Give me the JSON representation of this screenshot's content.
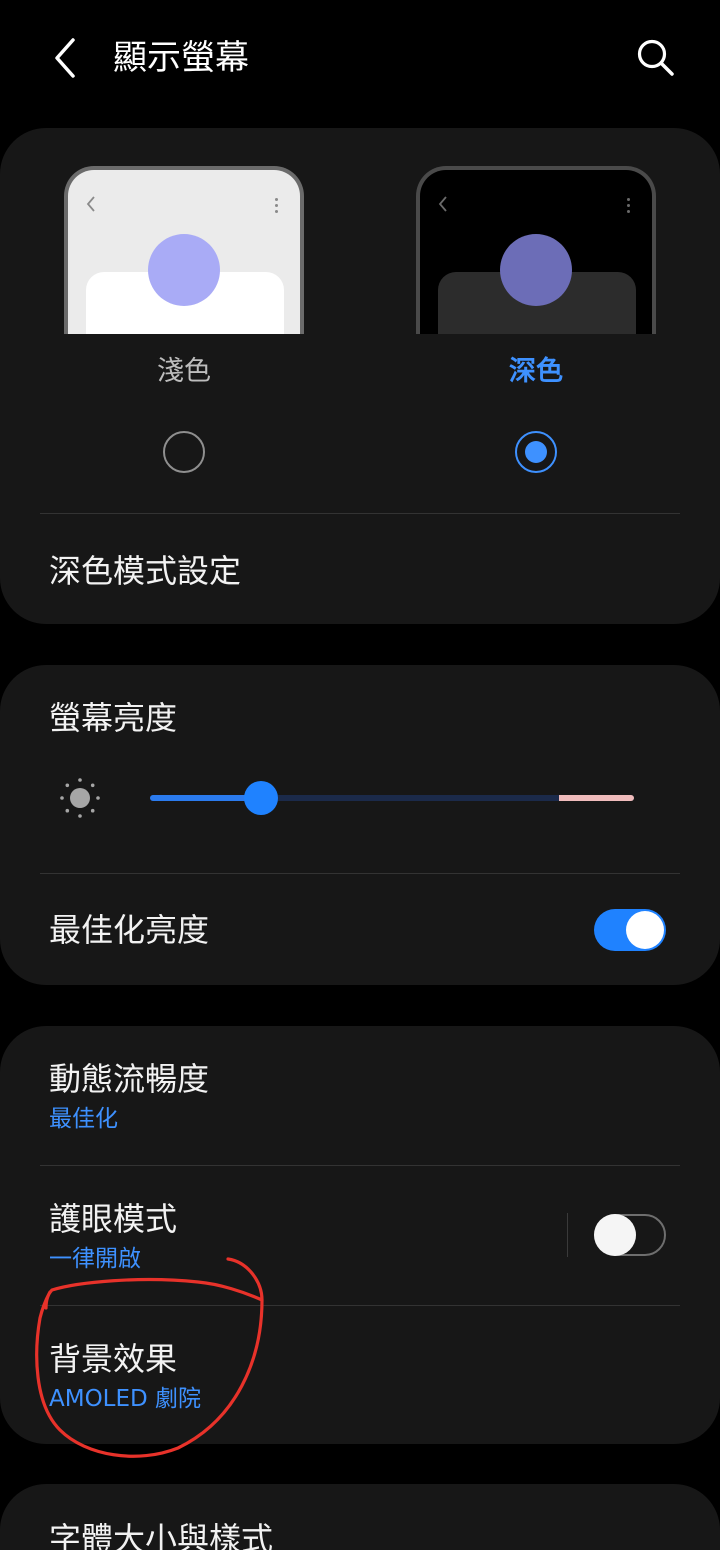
{
  "header": {
    "title": "顯示螢幕",
    "back_icon": "chevron-left-icon",
    "search_icon": "search-icon"
  },
  "theme": {
    "light_label": "淺色",
    "dark_label": "深色",
    "selected": "dark",
    "dark_mode_settings_label": "深色模式設定"
  },
  "brightness": {
    "title": "螢幕亮度",
    "level_percent": 23,
    "adaptive_label": "最佳化亮度",
    "adaptive_on": true
  },
  "settings": {
    "motion_smoothness_title": "動態流暢度",
    "motion_smoothness_value": "最佳化",
    "eye_comfort_title": "護眼模式",
    "eye_comfort_value": "一律開啟",
    "eye_comfort_on": false,
    "screen_mode_title": "背景效果",
    "screen_mode_value": "AMOLED 劇院"
  },
  "font": {
    "title": "字體大小與樣式"
  },
  "colors": {
    "accent": "#3e91ff",
    "toggle_on": "#1f82ff",
    "card_bg": "#171717",
    "annotation": "#e8322a"
  }
}
